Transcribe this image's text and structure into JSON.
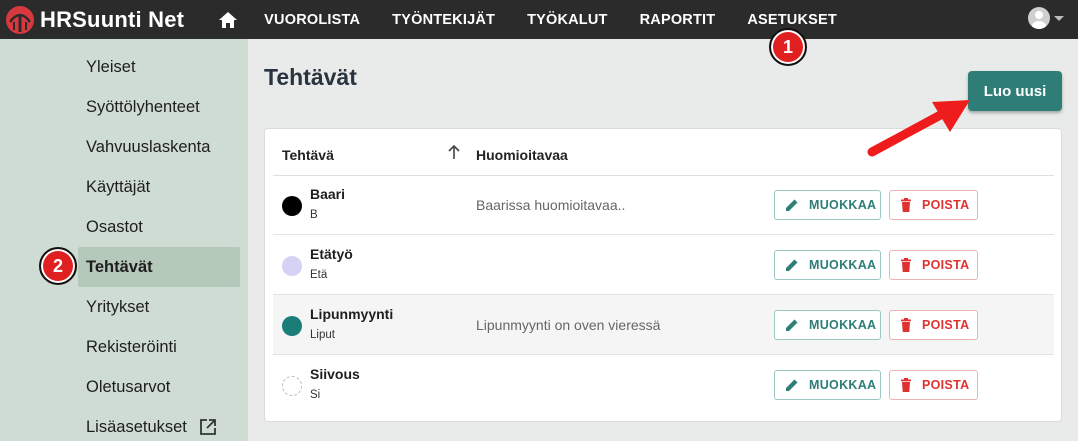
{
  "app": {
    "name": "HRSuunti Net"
  },
  "nav": {
    "items": [
      "VUOROLISTA",
      "TYÖNTEKIJÄT",
      "TYÖKALUT",
      "RAPORTIT",
      "ASETUKSET"
    ]
  },
  "sidebar": {
    "items": [
      {
        "label": "Yleiset"
      },
      {
        "label": "Syöttölyhenteet"
      },
      {
        "label": "Vahvuuslaskenta"
      },
      {
        "label": "Käyttäjät"
      },
      {
        "label": "Osastot"
      },
      {
        "label": "Tehtävät"
      },
      {
        "label": "Yritykset"
      },
      {
        "label": "Rekisteröinti"
      },
      {
        "label": "Oletusarvot"
      },
      {
        "label": "Lisäasetukset"
      }
    ],
    "active_index": 5
  },
  "page": {
    "title": "Tehtävät",
    "create_label": "Luo uusi"
  },
  "table": {
    "headers": {
      "task": "Tehtävä",
      "notes": "Huomioitavaa"
    },
    "rows": [
      {
        "name": "Baari",
        "abbr": "B",
        "note": "Baarissa huomioitavaa..",
        "color": "#000000"
      },
      {
        "name": "Etätyö",
        "abbr": "Etä",
        "note": "",
        "color": "#d4d2f5"
      },
      {
        "name": "Lipunmyynti",
        "abbr": "Liput",
        "note": "Lipunmyynti on oven vieressä",
        "color": "#1a7d77"
      },
      {
        "name": "Siivous",
        "abbr": "Si",
        "note": "",
        "color": "#ffffff"
      }
    ],
    "edit_label": "MUOKKAA",
    "delete_label": "POISTA"
  },
  "annotations": {
    "marker1": "1",
    "marker2": "2"
  },
  "colors": {
    "accent": "#2e7d76",
    "danger": "#e03131",
    "topbar": "#2b2b2b",
    "sidebar": "#cfdcd3",
    "marker": "#e02020"
  }
}
